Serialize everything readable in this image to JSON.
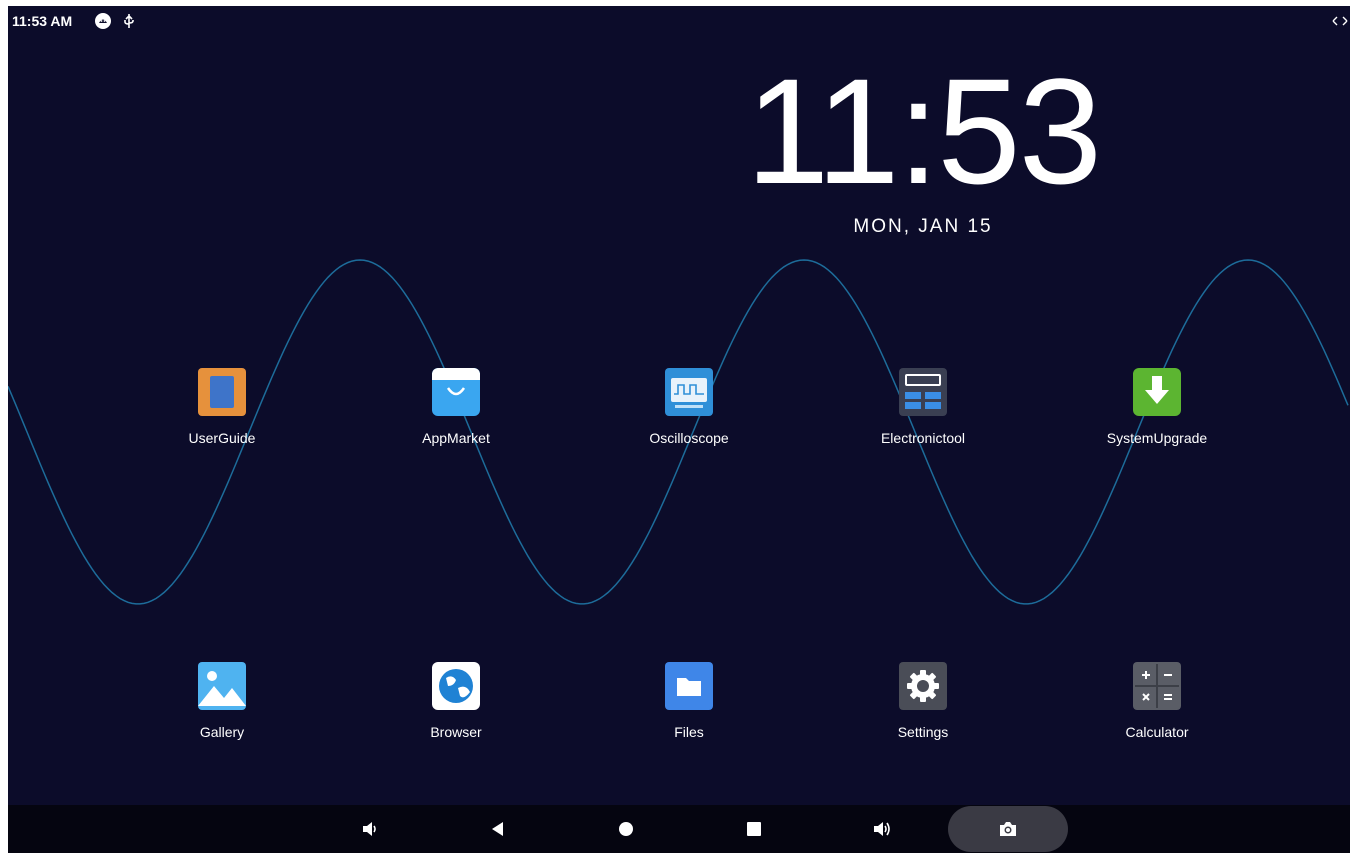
{
  "status_bar": {
    "time": "11:53 AM",
    "icons": [
      "android-debug-icon",
      "usb-icon",
      "collapse-arrows-icon"
    ]
  },
  "clock": {
    "time": "11:53",
    "date": "MON, JAN 15"
  },
  "apps": [
    {
      "label": "UserGuide",
      "icon": "user-guide-icon"
    },
    {
      "label": "AppMarket",
      "icon": "app-market-icon"
    },
    {
      "label": "Oscilloscope",
      "icon": "oscilloscope-icon"
    },
    {
      "label": "Electronictool",
      "icon": "electronic-tool-icon"
    },
    {
      "label": "SystemUpgrade",
      "icon": "system-upgrade-icon"
    },
    {
      "label": "Gallery",
      "icon": "gallery-icon"
    },
    {
      "label": "Browser",
      "icon": "browser-icon"
    },
    {
      "label": "Files",
      "icon": "files-icon"
    },
    {
      "label": "Settings",
      "icon": "settings-icon"
    },
    {
      "label": "Calculator",
      "icon": "calculator-icon"
    }
  ],
  "nav_bar": [
    "volume-down-icon",
    "back-icon",
    "home-icon",
    "recents-icon",
    "volume-up-icon",
    "screenshot-icon"
  ],
  "colors": {
    "background": "#0c0c2a",
    "wave": "#1d6c9a",
    "navbar": "#050510"
  }
}
